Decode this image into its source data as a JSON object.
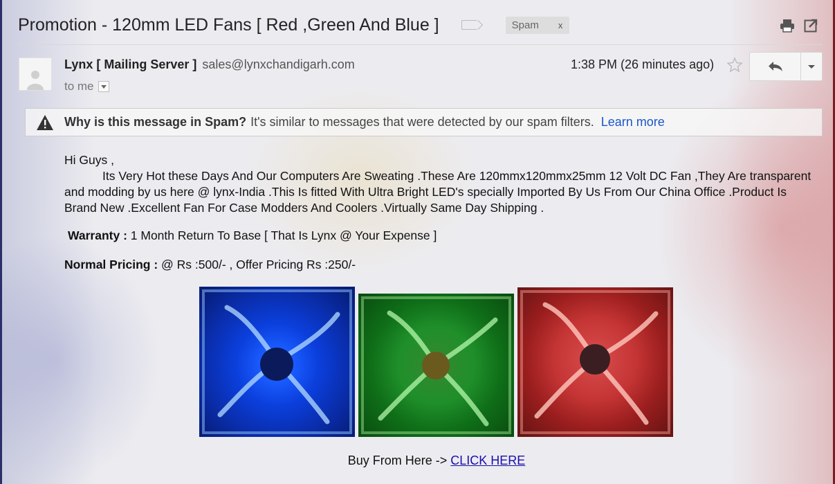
{
  "header": {
    "subject": "Promotion - 120mm LED Fans [ Red ,Green And Blue ]",
    "label_chip": "Spam",
    "label_remove": "x",
    "print_icon": "print-icon",
    "new_window_icon": "new-window-icon"
  },
  "sender": {
    "name": "Lynx [ Mailing Server ]",
    "email": "sales@lynxchandigarh.com",
    "recipient": "to me",
    "time": "1:38 PM (26 minutes ago)"
  },
  "spam_warning": {
    "question": "Why is this message in Spam?",
    "text": "It's similar to messages that were detected by our spam filters.",
    "link": "Learn more"
  },
  "message": {
    "greeting": "Hi Guys ,",
    "body": "Its Very Hot these Days And Our Computers Are Sweating .These Are 120mmx120mmx25mm 12 Volt DC Fan ,They Are transparent and modding by us here @ lynx-India .This Is fitted With Ultra Bright LED's specially Imported By Us From Our China Office .Product Is Brand New .Excellent Fan For Case Modders And Coolers .Virtually Same Day Shipping  .",
    "warranty_label": "Warranty :",
    "warranty_text": "1 Month Return To Base  [  That Is Lynx @ Your Expense ]",
    "pricing_label": "Normal Pricing :",
    "pricing_text": "@ Rs :500/- , Offer Pricing Rs :250/-",
    "buy_text": "Buy From Here ->",
    "buy_link": "CLICK HERE"
  },
  "colors": {
    "link": "#1a56c9",
    "buy_link": "#1a0dab",
    "fan_blue": "#1a5cff",
    "fan_green": "#2e8a2e",
    "fan_red": "#d24545"
  }
}
